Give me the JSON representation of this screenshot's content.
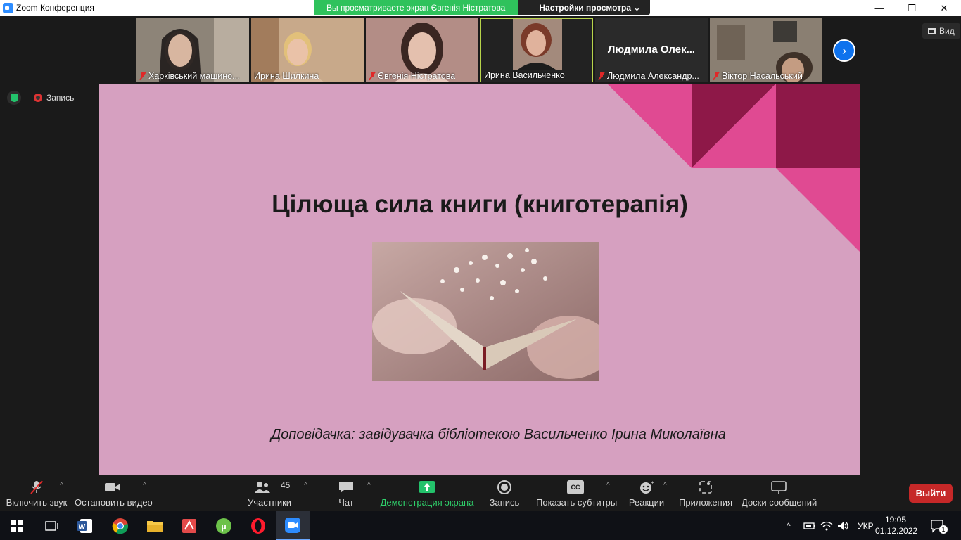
{
  "window": {
    "title": "Zoom Конференция",
    "minimize": "—",
    "maximize": "❐",
    "close": "✕"
  },
  "share_banner": {
    "status": "Вы просматриваете экран Євгенія Ністратова",
    "options": "Настройки просмотра"
  },
  "participants": [
    {
      "name": "Харківський машино...",
      "muted": true
    },
    {
      "name": "Ирина Шилкина",
      "muted": false
    },
    {
      "name": "Євгенія Ністратова",
      "muted": true
    },
    {
      "name": "Ирина Васильченко",
      "muted": false,
      "active_speaker": true
    },
    {
      "name": "Людмила Александр...",
      "muted": true,
      "video_label": "Людмила  Олек..."
    },
    {
      "name": "Віктор Насальський",
      "muted": true
    }
  ],
  "view_button": "Вид",
  "recording_label": "Запись",
  "slide": {
    "title": "Цілюща сила книги (книготерапія)",
    "subtitle": "Доповідачка: завідувачка бібліотекою Васильченко Ірина Миколаївна"
  },
  "toolbar": {
    "audio": "Включить звук",
    "video": "Остановить видео",
    "participants": "Участники",
    "participants_count": "45",
    "chat": "Чат",
    "share": "Демонстрация экрана",
    "record": "Запись",
    "captions": "Показать субтитры",
    "captions_icon": "CC",
    "reactions": "Реакции",
    "apps": "Приложения",
    "whiteboards": "Доски сообщений",
    "leave": "Выйти"
  },
  "taskbar": {
    "language": "УКР",
    "time": "19:05",
    "date": "01.12.2022",
    "notifications": "1"
  },
  "colors": {
    "share_green": "#2fc25c",
    "leave_red": "#c62828",
    "slide_bg": "#d6a0c0",
    "accent_pink": "#e04a92",
    "accent_maroon": "#8e1848"
  }
}
